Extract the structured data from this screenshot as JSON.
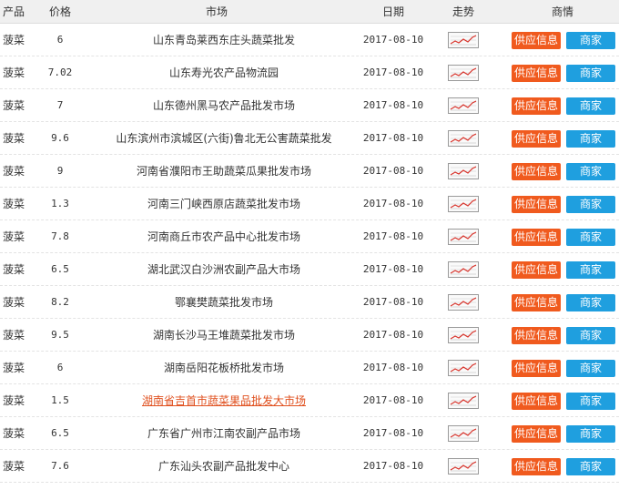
{
  "header": {
    "product": "产品",
    "price": "价格",
    "market": "市场",
    "date": "日期",
    "trend": "走势",
    "info": "商情"
  },
  "buttons": {
    "supply_label": "供应信息",
    "merchant_label": "商家"
  },
  "colors": {
    "supply_button": "#f05a1e",
    "merchant_button": "#1f9fdf",
    "link": "#e0501f"
  },
  "rows": [
    {
      "product": "菠菜",
      "price": "6",
      "market": "山东青岛莱西东庄头蔬菜批发",
      "date": "2017-08-10"
    },
    {
      "product": "菠菜",
      "price": "7.02",
      "market": "山东寿光农产品物流园",
      "date": "2017-08-10"
    },
    {
      "product": "菠菜",
      "price": "7",
      "market": "山东德州黑马农产品批发市场",
      "date": "2017-08-10"
    },
    {
      "product": "菠菜",
      "price": "9.6",
      "market": "山东滨州市滨城区(六街)鲁北无公害蔬菜批发",
      "date": "2017-08-10"
    },
    {
      "product": "菠菜",
      "price": "9",
      "market": "河南省濮阳市王助蔬菜瓜果批发市场",
      "date": "2017-08-10"
    },
    {
      "product": "菠菜",
      "price": "1.3",
      "market": "河南三门峡西原店蔬菜批发市场",
      "date": "2017-08-10"
    },
    {
      "product": "菠菜",
      "price": "7.8",
      "market": "河南商丘市农产品中心批发市场",
      "date": "2017-08-10"
    },
    {
      "product": "菠菜",
      "price": "6.5",
      "market": "湖北武汉白沙洲农副产品大市场",
      "date": "2017-08-10"
    },
    {
      "product": "菠菜",
      "price": "8.2",
      "market": "鄂襄樊蔬菜批发市场",
      "date": "2017-08-10"
    },
    {
      "product": "菠菜",
      "price": "9.5",
      "market": "湖南长沙马王堆蔬菜批发市场",
      "date": "2017-08-10"
    },
    {
      "product": "菠菜",
      "price": "6",
      "market": "湖南岳阳花板桥批发市场",
      "date": "2017-08-10"
    },
    {
      "product": "菠菜",
      "price": "1.5",
      "market": "湖南省吉首市蔬菜果品批发大市场",
      "date": "2017-08-10",
      "link": true
    },
    {
      "product": "菠菜",
      "price": "6.5",
      "market": "广东省广州市江南农副产品市场",
      "date": "2017-08-10"
    },
    {
      "product": "菠菜",
      "price": "7.6",
      "market": "广东汕头农副产品批发中心",
      "date": "2017-08-10"
    }
  ]
}
